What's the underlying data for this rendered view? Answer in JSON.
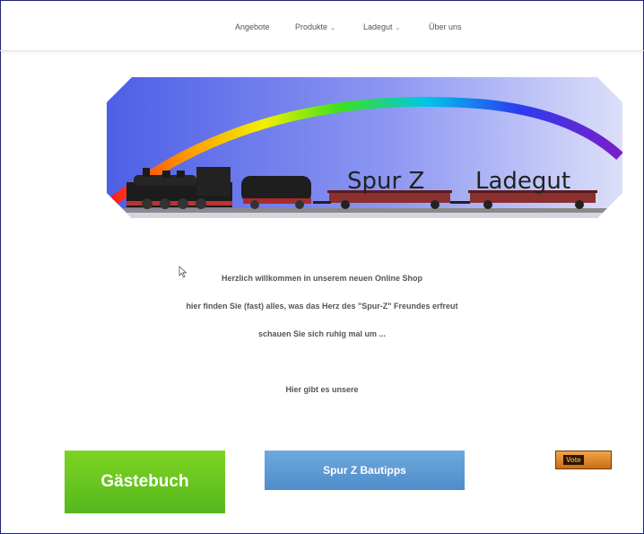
{
  "nav": {
    "items": [
      {
        "label": "Angebote",
        "has_dropdown": false
      },
      {
        "label": "Produkte",
        "has_dropdown": true
      },
      {
        "label": "Ladegut",
        "has_dropdown": true
      },
      {
        "label": "Über uns",
        "has_dropdown": false
      }
    ],
    "caret": "⌄"
  },
  "banner": {
    "title_part1": "Spur Z",
    "title_part2": "Ladegut"
  },
  "welcome": {
    "line1": "Herzlich willkommen in unserem neuen Online Shop",
    "line2": "hier finden Sie (fast) alles, was das Herz des \"Spur-Z\" Freundes erfreut",
    "line3": "schauen Sie sich ruhig mal um ...",
    "line4": "Hier gibt es unsere"
  },
  "buttons": {
    "guestbook": "Gästebuch",
    "tips": "Spur Z Bautipps",
    "vote": "Vote"
  },
  "colors": {
    "guestbook": "#6cc524",
    "tips": "#5b98d3",
    "vote": "#e08a2e",
    "banner_blue": "#6f7ff0"
  }
}
